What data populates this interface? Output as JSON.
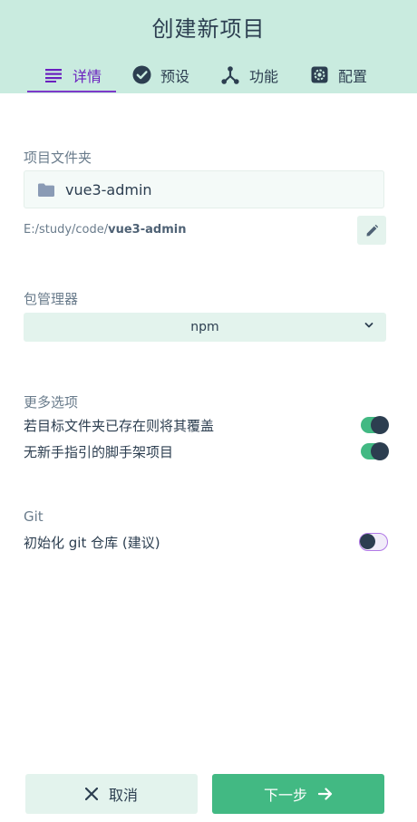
{
  "header": {
    "title": "创建新项目"
  },
  "tabs": [
    {
      "label": "详情",
      "icon": "list-icon",
      "active": true
    },
    {
      "label": "预设",
      "icon": "check-circle-icon",
      "active": false
    },
    {
      "label": "功能",
      "icon": "branch-icon",
      "active": false
    },
    {
      "label": "配置",
      "icon": "gear-icon",
      "active": false
    }
  ],
  "project_folder": {
    "label": "项目文件夹",
    "name": "vue3-admin",
    "path_prefix": "E:/study/code/",
    "path_name": "vue3-admin"
  },
  "package_manager": {
    "label": "包管理器",
    "selected": "npm"
  },
  "more_options": {
    "label": "更多选项",
    "items": [
      {
        "label": "若目标文件夹已存在则将其覆盖",
        "enabled": true
      },
      {
        "label": "无新手指引的脚手架项目",
        "enabled": true
      }
    ]
  },
  "git": {
    "label": "Git",
    "items": [
      {
        "label": "初始化 git 仓库 (建议)",
        "enabled": false
      }
    ]
  },
  "footer": {
    "cancel_label": "取消",
    "next_label": "下一步"
  },
  "colors": {
    "header_bg": "#c9ebdf",
    "accent_green": "#42b983",
    "active_tab": "#6a1fbf",
    "text_dark": "#2c3e50"
  }
}
